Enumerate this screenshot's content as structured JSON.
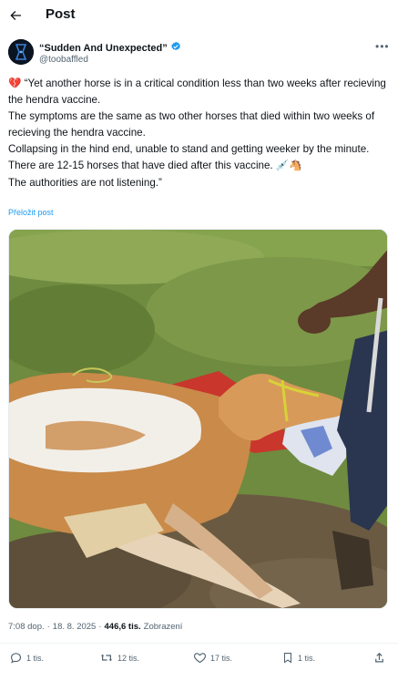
{
  "header": {
    "title": "Post",
    "back_icon": "arrow-left-icon"
  },
  "author": {
    "display_name": "“Sudden And Unexpected”",
    "handle": "@toobaffled",
    "verified_icon": "verified-badge-icon",
    "verified_color": "#1d9bf0",
    "more_icon": "more-horizontal-icon"
  },
  "tweet": {
    "lines": [
      "“Yet another horse is in a critical condition less than two weeks after recieving the hendra vaccine.",
      "The symptoms are the same as two other horses that died within two weeks of recieving the hendra vaccine.",
      "Collapsing in the hind end, unable to stand and getting weeker by the minute.",
      "There are 12-15 horses that have died after this vaccine.",
      "The authorities are not listening.”"
    ],
    "leading_emoji": "💔",
    "inline_emojis": "💉🐴",
    "translate_label": "Přeložit post"
  },
  "meta": {
    "time": "7:08 dop.",
    "separator": "·",
    "date": "18. 8. 2025",
    "views": "446,6 tis.",
    "views_label": "Zobrazení"
  },
  "actions": {
    "reply": {
      "icon": "reply-icon",
      "count": "1 tis."
    },
    "repost": {
      "icon": "repost-icon",
      "count": "12 tis."
    },
    "like": {
      "icon": "heart-icon",
      "count": "17 tis."
    },
    "bookmark": {
      "icon": "bookmark-icon",
      "count": "1 tis."
    },
    "share": {
      "icon": "share-icon"
    }
  },
  "colors": {
    "accent": "#1d9bf0",
    "text": "#0f1419",
    "muted": "#536471"
  }
}
